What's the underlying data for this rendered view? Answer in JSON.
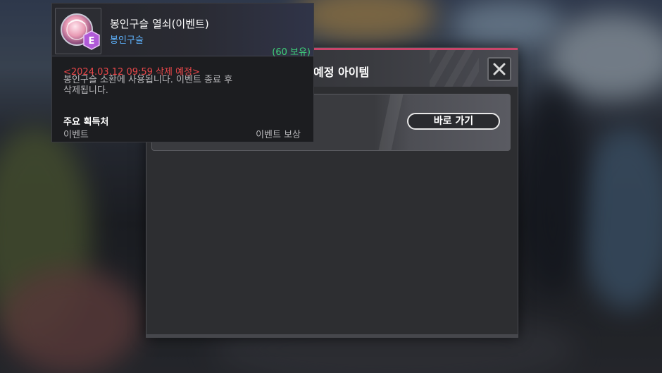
{
  "dialog": {
    "title": "예정 아이템",
    "goto_button": "바로 가기"
  },
  "tooltip": {
    "item_name": "봉인구슬 열쇠(이벤트)",
    "item_category": "봉인구슬",
    "owned": "(60 보유)",
    "icon_badge": "E",
    "expire": "<2024.03.12 09:59 삭제 예정>",
    "description_line1": "봉인구슬 소환에 사용됩니다. 이벤트 종료 후",
    "description_line2": "삭제됩니다.",
    "source_title": "주요 획득처",
    "source_type": "이벤트",
    "source_detail": "이벤트 보상"
  },
  "colors": {
    "accent_pink": "#c8456a",
    "owned_green": "#3fd27a",
    "category_blue": "#5fb4ff",
    "expire_red": "#e8474a",
    "icon_badge_purple": "#b05ad8"
  },
  "icons": {
    "close": "close-icon",
    "item": "seal-orb-key-icon"
  }
}
